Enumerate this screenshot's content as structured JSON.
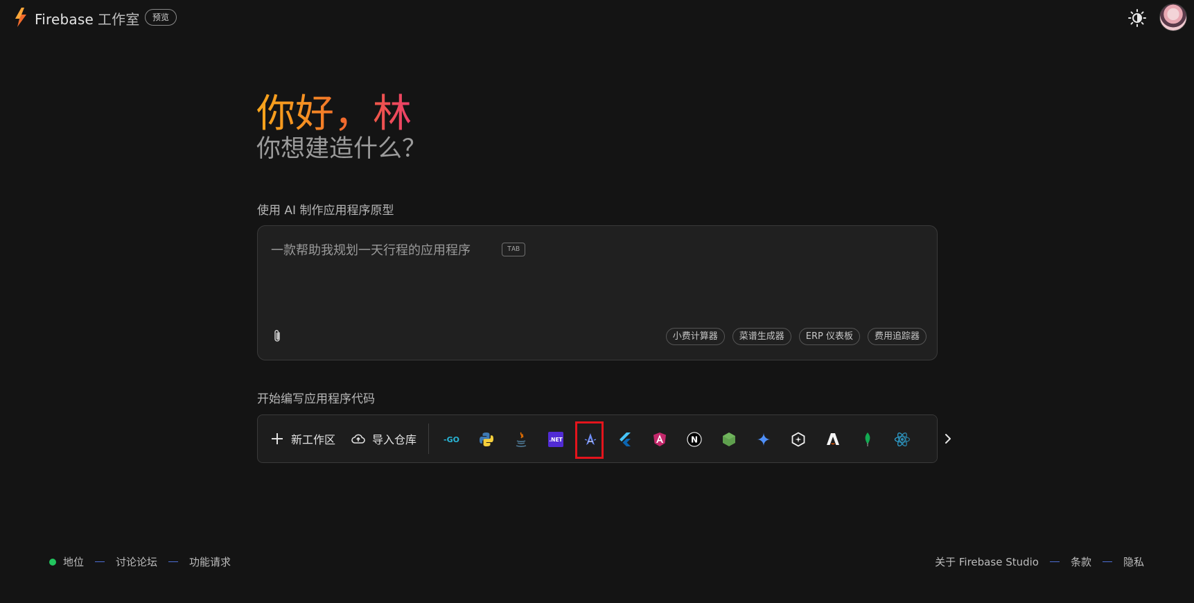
{
  "header": {
    "brand_name": "Firebase",
    "brand_suffix": "工作室",
    "badge": "预览"
  },
  "greeting": {
    "hello": "你好，林",
    "question": "你想建造什么？"
  },
  "prototype": {
    "label": "使用 AI 制作应用程序原型",
    "placeholder": "一款帮助我规划一天行程的应用程序",
    "tab_hint": "TAB",
    "suggestions": [
      "小费计算器",
      "菜谱生成器",
      "ERP 仪表板",
      "费用追踪器"
    ]
  },
  "code": {
    "label": "开始编写应用程序代码",
    "new_workspace": "新工作区",
    "import_repo": "导入仓库",
    "templates": [
      {
        "icon": "go-icon"
      },
      {
        "icon": "python-icon"
      },
      {
        "icon": "java-icon"
      },
      {
        "icon": "dotnet-icon",
        "text": ".NET"
      },
      {
        "icon": "astro-icon"
      },
      {
        "icon": "flutter-icon"
      },
      {
        "icon": "angular-icon"
      },
      {
        "icon": "nextjs-icon",
        "text": "N"
      },
      {
        "icon": "nodejs-icon"
      },
      {
        "icon": "gemini-icon"
      },
      {
        "icon": "hexagon-template-icon"
      },
      {
        "icon": "astro-a-icon"
      },
      {
        "icon": "mongodb-icon"
      },
      {
        "icon": "react-icon"
      }
    ],
    "highlighted_template": "astro-icon"
  },
  "footer": {
    "status": "地位",
    "forum": "讨论论坛",
    "feature_request": "功能请求",
    "about": "关于 Firebase Studio",
    "terms": "条款",
    "privacy": "隐私"
  },
  "colors": {
    "background": "#141414",
    "status_dot": "#22c55e",
    "highlight": "#e4141c",
    "greeting_gradient": [
      "#f7a51c",
      "#ec3f6a"
    ]
  }
}
